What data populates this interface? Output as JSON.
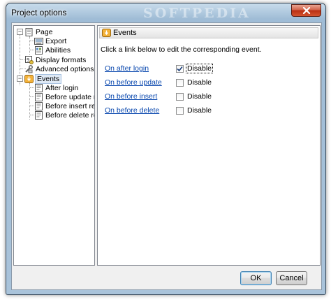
{
  "window": {
    "title": "Project options",
    "watermark": "SOFTPEDIA"
  },
  "tree": {
    "items": [
      {
        "label": "Page",
        "icon": "page-icon",
        "expander": "−"
      },
      {
        "label": "Export",
        "icon": "export-icon"
      },
      {
        "label": "Abilities",
        "icon": "abilities-icon"
      },
      {
        "label": "Display formats",
        "icon": "display-formats-icon"
      },
      {
        "label": "Advanced options",
        "icon": "advanced-options-icon"
      },
      {
        "label": "Events",
        "icon": "events-icon",
        "expander": "−"
      },
      {
        "label": "After login",
        "icon": "event-item-icon"
      },
      {
        "label": "Before update re",
        "icon": "event-item-icon"
      },
      {
        "label": "Before insert rec",
        "icon": "event-item-icon"
      },
      {
        "label": "Before delete rec",
        "icon": "event-item-icon"
      }
    ]
  },
  "panel": {
    "header": "Events",
    "instruction": "Click a link below to edit the corresponding event.",
    "events": [
      {
        "link": "On after login",
        "checkbox_label": "Disable",
        "checked": true
      },
      {
        "link": "On before update",
        "checkbox_label": "Disable",
        "checked": false
      },
      {
        "link": "On before insert",
        "checkbox_label": "Disable",
        "checked": false
      },
      {
        "link": "On before delete",
        "checkbox_label": "Disable",
        "checked": false
      }
    ]
  },
  "buttons": {
    "ok": "OK",
    "cancel": "Cancel"
  },
  "colors": {
    "link": "#0645ad",
    "selection": "#dfe9f5",
    "close_button": "#c4391f",
    "events_icon": "#e8a020"
  }
}
